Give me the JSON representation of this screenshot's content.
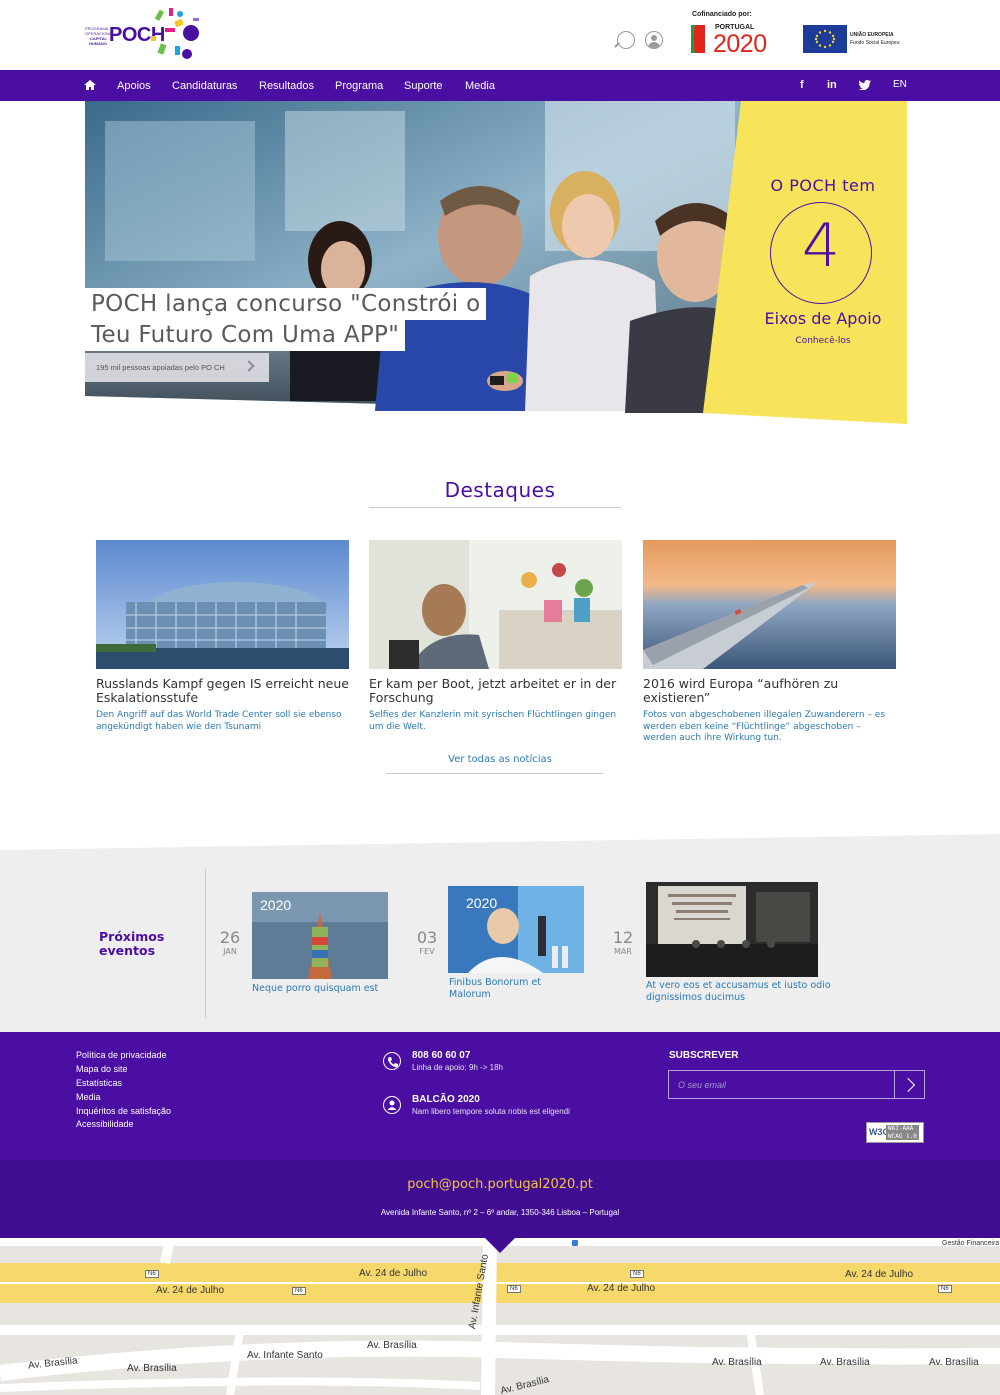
{
  "header": {
    "logo_small": [
      "PROGRAMA",
      "OPERACIONAL",
      "CAPITAL",
      "HUMANO"
    ],
    "logo_word": "POCH",
    "cofinanciado": "Cofinanciado por:",
    "portugal_small": "PORTUGAL",
    "portugal_big": "2020",
    "eu_label_1": "UNIÃO EUROPEIA",
    "eu_label_2": "Fundo Social Europeu"
  },
  "nav": {
    "items": [
      "Apoios",
      "Candidaturas",
      "Resultados",
      "Programa",
      "Suporte",
      "Media"
    ],
    "social": [
      "f",
      "in"
    ],
    "lang": "EN"
  },
  "hero": {
    "title_line1": "POCH lança concurso \"Constrói o",
    "title_line2": "Teu Futuro Com Uma APP\"",
    "link_text": "195 mil pessoas apoiadas pelo PO CH",
    "stat_head": "O POCH tem",
    "stat_number": "4",
    "stat_label": "Eixos de Apoio",
    "stat_link": "Conhecê-los",
    "panel_color": "#f7e45a"
  },
  "destaques": {
    "title": "Destaques",
    "cards": [
      {
        "title": "Russlands Kampf gegen IS erreicht neue Eskalationsstufe",
        "desc": "Den Angriff auf das World Trade Center soll sie ebenso angekündigt haben wie den Tsunami"
      },
      {
        "title": "Er kam per Boot, jetzt arbeitet er in der Forschung",
        "desc": "Selfies der Kanzlerin mit syrischen Flüchtlingen gingen um die Welt."
      },
      {
        "title": "2016 wird Europa “aufhören zu existieren”",
        "desc": "Fotos von abgeschobenen illegalen Zuwanderern – es werden eben keine “Flüchtlinge” abgeschoben – werden auch ihre Wirkung tun."
      }
    ],
    "all_news": "Ver todas as notícias"
  },
  "events": {
    "label_1": "Próximos",
    "label_2": "eventos",
    "items": [
      {
        "day": "26",
        "month": "JAN",
        "title_1": "Neque porro quisquam est",
        "title_2": "",
        "img_label": "2020"
      },
      {
        "day": "03",
        "month": "FEV",
        "title_1": "Finibus Bonorum et",
        "title_2": "Malorum",
        "img_label": "2020"
      },
      {
        "day": "12",
        "month": "MAR",
        "title_1": "At vero eos et accusamus et iusto odio",
        "title_2": "dignissimos ducimus",
        "img_label": ""
      }
    ]
  },
  "footer": {
    "links": [
      "Política de privacidade",
      "Mapa do site",
      "Estatísticas",
      "Media",
      "Inquéritos de satisfação",
      "Acessibilidade"
    ],
    "phone": "808 60 60 07",
    "phone_sub": "Linha de apoio: 9h -> 18h",
    "balcao": "BALCÃO 2020",
    "balcao_sub": "Nam libero tempore soluta nobis est eligendi",
    "subscribe_title": "SUBSCREVER",
    "subscribe_placeholder": "O seu email",
    "w3c": "W3C",
    "wai_1": "WAI-AAA",
    "wai_2": "WCAG 1.0",
    "email": "poch@poch.portugal2020.pt",
    "address": "Avenida Infante Santo, nº 2 – 6º andar, 1350-346 Lisboa – Portugal"
  },
  "map": {
    "labels": [
      "Av. 24 de Julho",
      "Av. 24 de Julho",
      "Av. 24 de Julho",
      "Av. 24 de Julho",
      "Av. Infante Santo",
      "Av. Infante Santo",
      "Av. Brasília",
      "Av. Brasília",
      "Av. Brasília",
      "Av. Brasília",
      "Av. Brasília",
      "Av. Brasília",
      "Av. Brasília"
    ],
    "road_code": "N6",
    "corner_label": "Gestão Financeira"
  }
}
